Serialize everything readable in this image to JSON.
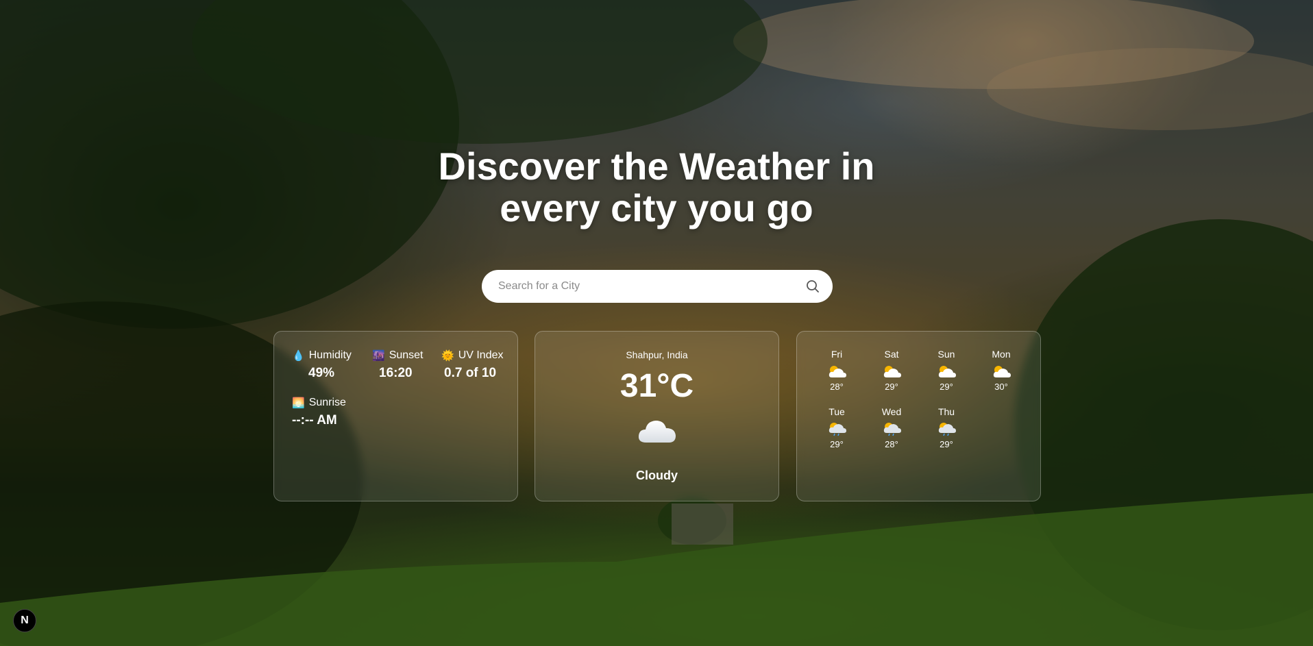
{
  "headline": {
    "line1": "Discover the Weather in",
    "line2": "every city you go"
  },
  "search": {
    "placeholder": "Search for a City",
    "value": "",
    "icon": "search-icon"
  },
  "stats": {
    "humidity": {
      "label": "Humidity",
      "value": "49%",
      "icon": "droplet-icon"
    },
    "sunset": {
      "label": "Sunset",
      "value": "16:20",
      "icon": "sunset-icon"
    },
    "uv": {
      "label": "UV Index",
      "value": "0.7 of 10",
      "icon": "sun-face-icon"
    },
    "sunrise": {
      "label": "Sunrise",
      "value": "--:-- AM",
      "icon": "sunrise-icon"
    }
  },
  "current": {
    "city": "Shahpur, India",
    "temp": "31°C",
    "condition": "Cloudy",
    "icon": "cloud-icon"
  },
  "forecast": [
    {
      "day": "Fri",
      "temp": "28°",
      "icon": "sun-behind-cloud-icon"
    },
    {
      "day": "Sat",
      "temp": "29°",
      "icon": "sun-behind-cloud-icon"
    },
    {
      "day": "Sun",
      "temp": "29°",
      "icon": "sun-behind-cloud-icon"
    },
    {
      "day": "Mon",
      "temp": "30°",
      "icon": "sun-behind-cloud-icon"
    },
    {
      "day": "Tue",
      "temp": "29°",
      "icon": "sun-rain-cloud-icon"
    },
    {
      "day": "Wed",
      "temp": "28°",
      "icon": "sun-rain-cloud-icon"
    },
    {
      "day": "Thu",
      "temp": "29°",
      "icon": "sun-rain-cloud-icon"
    }
  ],
  "badge": {
    "label": "N"
  },
  "colors": {
    "card_border": "#ffffff47",
    "search_bg": "#ffffff",
    "text": "#ffffff"
  }
}
